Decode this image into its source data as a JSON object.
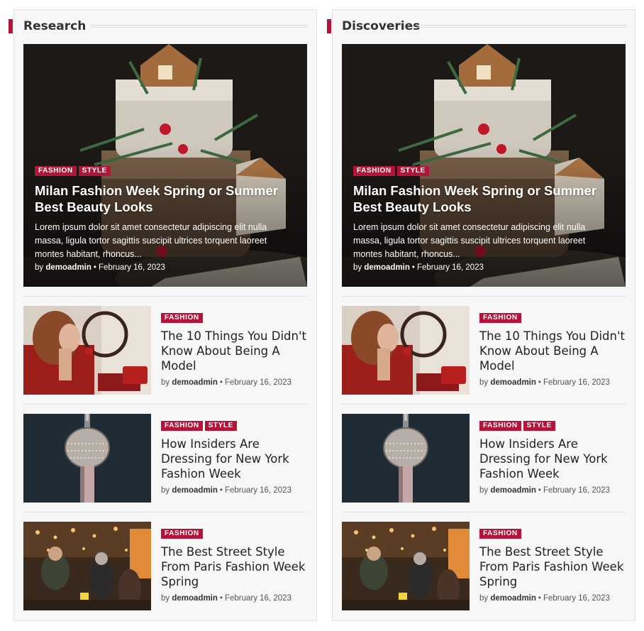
{
  "colors": {
    "accent": "#b3153a",
    "panel_bg": "#f7f7f7"
  },
  "panels": [
    {
      "section_title": "Research",
      "featured": {
        "tags": [
          "FASHION",
          "STYLE"
        ],
        "title": "Milan Fashion Week Spring or Summer Best Beauty Looks",
        "excerpt": "Lorem ipsum dolor sit amet consectetur adipiscing elit nulla massa, ligula tortor sagittis suscipit ultrices torquent laoreet montes habitant, rhoncus...",
        "by": "by",
        "author": "demoadmin",
        "date": "February 16, 2023",
        "image": "gingerbread-cake-photo"
      },
      "items": [
        {
          "tags": [
            "FASHION"
          ],
          "title": "The 10 Things You Didn't Know About Being A Model",
          "by": "by",
          "author": "demoadmin",
          "date": "February 16, 2023",
          "image": "woman-telephone-photo"
        },
        {
          "tags": [
            "FASHION",
            "STYLE"
          ],
          "title": "How Insiders Are Dressing for New York Fashion Week",
          "by": "by",
          "author": "demoadmin",
          "date": "February 16, 2023",
          "image": "tv-tower-photo"
        },
        {
          "tags": [
            "FASHION"
          ],
          "title": "The Best Street Style From Paris Fashion Week Spring",
          "by": "by",
          "author": "demoadmin",
          "date": "February 16, 2023",
          "image": "christmas-market-photo"
        }
      ]
    },
    {
      "section_title": "Discoveries",
      "featured": {
        "tags": [
          "FASHION",
          "STYLE"
        ],
        "title": "Milan Fashion Week Spring or Summer Best Beauty Looks",
        "excerpt": "Lorem ipsum dolor sit amet consectetur adipiscing elit nulla massa, ligula tortor sagittis suscipit ultrices torquent laoreet montes habitant, rhoncus...",
        "by": "by",
        "author": "demoadmin",
        "date": "February 16, 2023",
        "image": "gingerbread-cake-photo"
      },
      "items": [
        {
          "tags": [
            "FASHION"
          ],
          "title": "The 10 Things You Didn't Know About Being A Model",
          "by": "by",
          "author": "demoadmin",
          "date": "February 16, 2023",
          "image": "woman-telephone-photo"
        },
        {
          "tags": [
            "FASHION",
            "STYLE"
          ],
          "title": "How Insiders Are Dressing for New York Fashion Week",
          "by": "by",
          "author": "demoadmin",
          "date": "February 16, 2023",
          "image": "tv-tower-photo"
        },
        {
          "tags": [
            "FASHION"
          ],
          "title": "The Best Street Style From Paris Fashion Week Spring",
          "by": "by",
          "author": "demoadmin",
          "date": "February 16, 2023",
          "image": "christmas-market-photo"
        }
      ]
    }
  ]
}
